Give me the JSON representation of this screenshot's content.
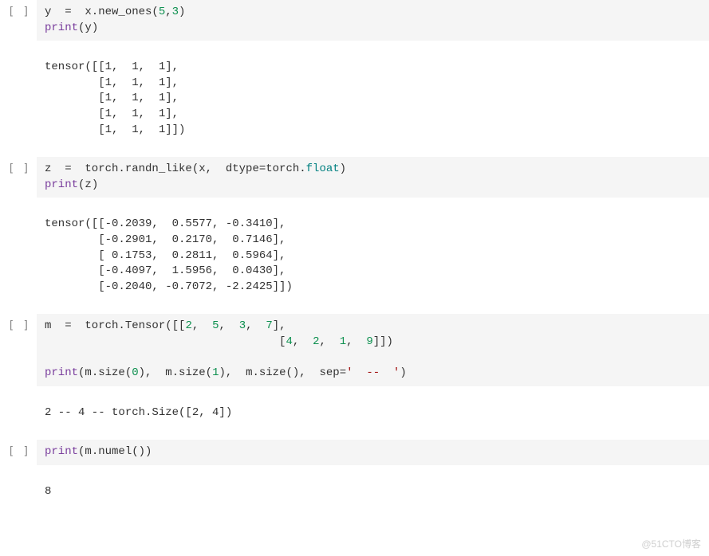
{
  "cells": [
    {
      "prompt": "[ ]",
      "code_tokens": [
        [
          {
            "t": "y  =  x.new_ones(",
            "c": ""
          },
          {
            "t": "5",
            "c": "tok-n"
          },
          {
            "t": ",",
            "c": ""
          },
          {
            "t": "3",
            "c": "tok-n"
          },
          {
            "t": ")",
            "c": ""
          }
        ],
        [
          {
            "t": "print",
            "c": "tok-fn"
          },
          {
            "t": "(y)",
            "c": ""
          }
        ]
      ],
      "output": "tensor([[1,  1,  1],\n        [1,  1,  1],\n        [1,  1,  1],\n        [1,  1,  1],\n        [1,  1,  1]])"
    },
    {
      "prompt": "[ ]",
      "code_tokens": [
        [
          {
            "t": "z  =  torch.randn_like(x,  dtype=torch.",
            "c": ""
          },
          {
            "t": "float",
            "c": "tok-kw"
          },
          {
            "t": ")",
            "c": ""
          }
        ],
        [
          {
            "t": "print",
            "c": "tok-fn"
          },
          {
            "t": "(z)",
            "c": ""
          }
        ]
      ],
      "output": "tensor([[-0.2039,  0.5577, -0.3410],\n        [-0.2901,  0.2170,  0.7146],\n        [ 0.1753,  0.2811,  0.5964],\n        [-0.4097,  1.5956,  0.0430],\n        [-0.2040, -0.7072, -2.2425]])"
    },
    {
      "prompt": "[ ]",
      "code_tokens": [
        [
          {
            "t": "m  =  torch.Tensor([[",
            "c": ""
          },
          {
            "t": "2",
            "c": "tok-n"
          },
          {
            "t": ",  ",
            "c": ""
          },
          {
            "t": "5",
            "c": "tok-n"
          },
          {
            "t": ",  ",
            "c": ""
          },
          {
            "t": "3",
            "c": "tok-n"
          },
          {
            "t": ",  ",
            "c": ""
          },
          {
            "t": "7",
            "c": "tok-n"
          },
          {
            "t": "],",
            "c": ""
          }
        ],
        [
          {
            "t": "                                   [",
            "c": ""
          },
          {
            "t": "4",
            "c": "tok-n"
          },
          {
            "t": ",  ",
            "c": ""
          },
          {
            "t": "2",
            "c": "tok-n"
          },
          {
            "t": ",  ",
            "c": ""
          },
          {
            "t": "1",
            "c": "tok-n"
          },
          {
            "t": ",  ",
            "c": ""
          },
          {
            "t": "9",
            "c": "tok-n"
          },
          {
            "t": "]])",
            "c": ""
          }
        ],
        [
          {
            "t": "",
            "c": ""
          }
        ],
        [
          {
            "t": "print",
            "c": "tok-fn"
          },
          {
            "t": "(m.size(",
            "c": ""
          },
          {
            "t": "0",
            "c": "tok-n"
          },
          {
            "t": "),  m.size(",
            "c": ""
          },
          {
            "t": "1",
            "c": "tok-n"
          },
          {
            "t": "),  m.size(),  sep=",
            "c": ""
          },
          {
            "t": "'  --  '",
            "c": "tok-str"
          },
          {
            "t": ")",
            "c": ""
          }
        ]
      ],
      "output": "2 -- 4 -- torch.Size([2, 4])"
    },
    {
      "prompt": "[ ]",
      "code_tokens": [
        [
          {
            "t": "print",
            "c": "tok-fn"
          },
          {
            "t": "(m.numel())",
            "c": ""
          }
        ]
      ],
      "output": "8"
    }
  ],
  "watermark": "@51CTO博客"
}
